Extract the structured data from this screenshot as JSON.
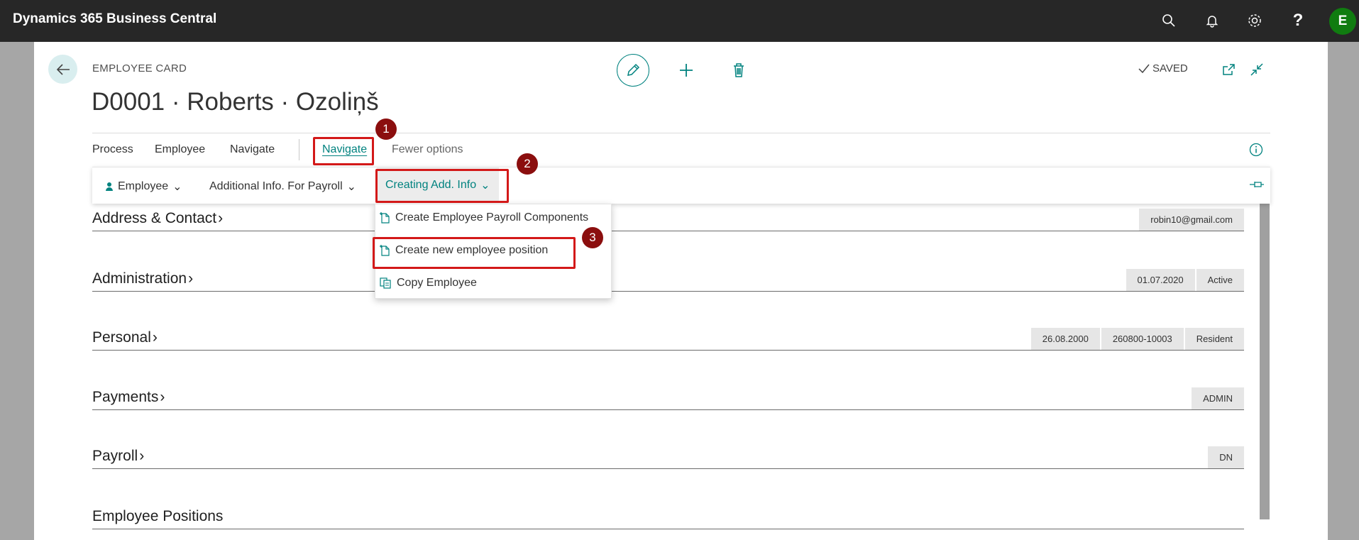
{
  "app": {
    "title": "Dynamics 365 Business Central",
    "user_initial": "E"
  },
  "topbar_icons": [
    "search-icon",
    "bell-icon",
    "gear-icon",
    "help-icon"
  ],
  "page": {
    "caption": "EMPLOYEE CARD",
    "title": "D0001 · Roberts · Ozoliņš",
    "status": "SAVED"
  },
  "tabs": [
    {
      "label": "Process"
    },
    {
      "label": "Employee"
    },
    {
      "label": "Navigate"
    },
    {
      "label": "Navigate"
    },
    {
      "label": "Fewer options"
    }
  ],
  "actionbar": {
    "employee_label": "Employee",
    "payroll_label": "Additional Info. For Payroll",
    "creating_label": "Creating Add. Info"
  },
  "dropdown": {
    "items": [
      {
        "label": "Create Employee Payroll Components",
        "icon": "new-document-icon"
      },
      {
        "label": "Create new employee position",
        "icon": "new-document-icon"
      },
      {
        "label": "Copy Employee",
        "icon": "copy-icon"
      }
    ]
  },
  "markers": [
    "1",
    "2",
    "3"
  ],
  "fasttabs": [
    {
      "title": "Address & Contact",
      "pills": [
        "robin10@gmail.com"
      ]
    },
    {
      "title": "Administration",
      "pills": [
        "01.07.2020",
        "Active"
      ]
    },
    {
      "title": "Personal",
      "pills": [
        "26.08.2000",
        "260800-10003",
        "Resident"
      ]
    },
    {
      "title": "Payments",
      "pills": [
        "ADMIN"
      ]
    },
    {
      "title": "Payroll",
      "pills": [
        "DN"
      ]
    },
    {
      "title": "Employee Positions",
      "pills": []
    }
  ],
  "colors": {
    "accent": "#00827f",
    "topbar": "#272727",
    "highlight": "#d31919",
    "marker": "#8b0e0e",
    "avatar": "#107c10"
  }
}
